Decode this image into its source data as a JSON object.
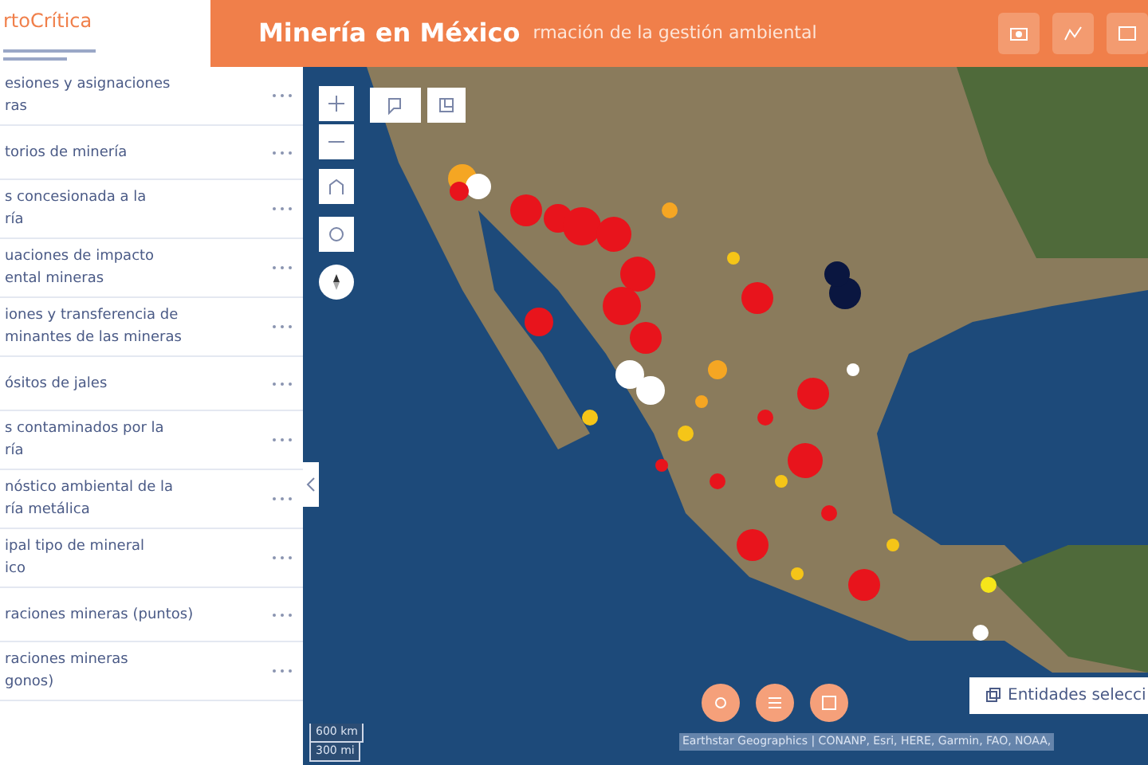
{
  "header": {
    "logo_text": "rtoCrítica",
    "title": "Minería en México",
    "subtitle": "rmación de la gestión ambiental"
  },
  "sidebar": {
    "items": [
      {
        "lines": [
          "esiones y asignaciones",
          "ras"
        ]
      },
      {
        "lines": [
          "torios de minería"
        ]
      },
      {
        "lines": [
          "s concesionada a la",
          "ría"
        ]
      },
      {
        "lines": [
          "uaciones de impacto",
          "ental mineras"
        ]
      },
      {
        "lines": [
          "iones y transferencia de",
          "minantes de las mineras"
        ]
      },
      {
        "lines": [
          "ósitos de jales"
        ]
      },
      {
        "lines": [
          "s contaminados por la",
          "ría"
        ]
      },
      {
        "lines": [
          "nóstico ambiental de la",
          "ría metálica"
        ]
      },
      {
        "lines": [
          "ipal tipo de mineral",
          "ico"
        ]
      },
      {
        "lines": [
          "raciones mineras (puntos)"
        ]
      },
      {
        "lines": [
          "raciones mineras",
          "gonos)"
        ]
      }
    ]
  },
  "map": {
    "selection_button": "Entidades selecci",
    "scale": [
      "600 km",
      "300 mi"
    ],
    "attribution": "Earthstar Geographics | CONANP, Esri, HERE, Garmin, FAO, NOAA,"
  }
}
